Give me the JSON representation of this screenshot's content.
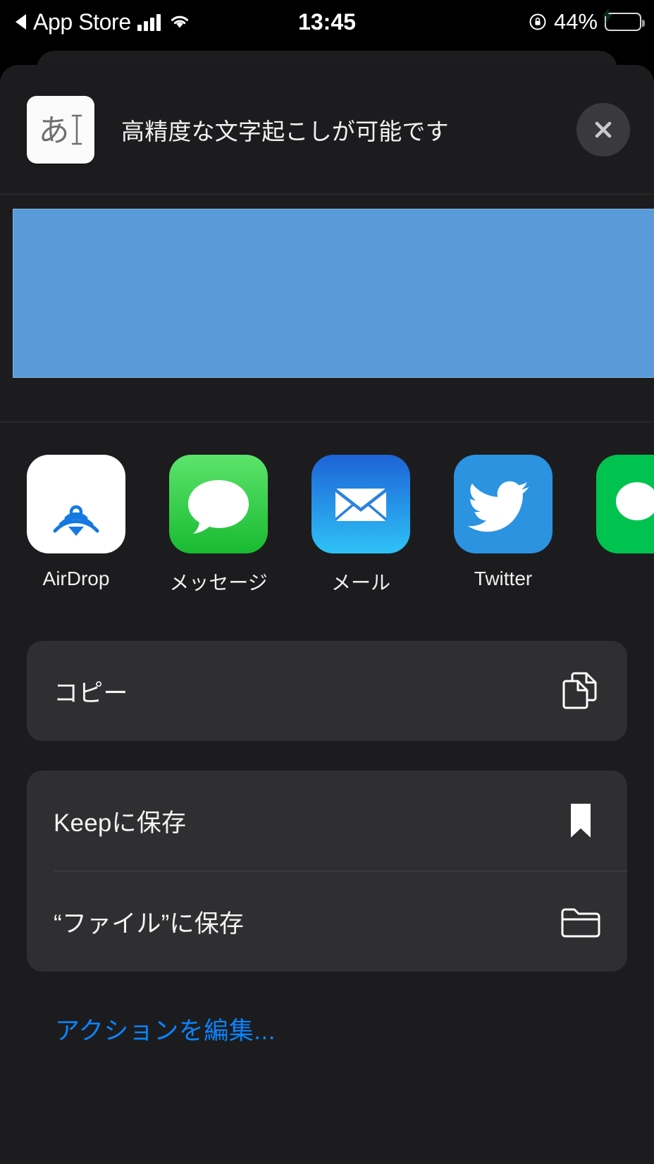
{
  "status_bar": {
    "back_arrow_icon": "triangle-left-icon",
    "carrier_return_app": "App Store",
    "signal_icon": "cellular-signal-icon",
    "wifi_icon": "wifi-icon",
    "time": "13:45",
    "rotation_lock_icon": "rotation-lock-icon",
    "battery_percent": "44%",
    "battery_icon": "battery-charging-icon"
  },
  "sheet": {
    "app_icon_name": "japanese-text-recognition-icon",
    "app_icon_glyph": "あ",
    "app_icon_cursor": "I",
    "title": "高精度な文字起こしが可能です",
    "close_icon": "close-icon"
  },
  "preview": {
    "name": "shared-image-preview",
    "color": "#589bd8"
  },
  "apps": [
    {
      "label": "AirDrop",
      "icon": "airdrop-icon",
      "color": "#ffffff"
    },
    {
      "label": "メッセージ",
      "icon": "messages-icon",
      "color": "#34c759"
    },
    {
      "label": "メール",
      "icon": "mail-icon",
      "color": "#1d8fe8"
    },
    {
      "label": "Twitter",
      "icon": "twitter-icon",
      "color": "#1d9bf0"
    },
    {
      "label": "",
      "icon": "line-icon",
      "color": "#00c34f"
    }
  ],
  "actions": {
    "copy": {
      "label": "コピー",
      "icon": "copy-documents-icon"
    },
    "save_keep": {
      "label": "Keepに保存",
      "icon": "bookmark-icon"
    },
    "save_files": {
      "label": "“ファイル”に保存",
      "icon": "folder-icon"
    }
  },
  "edit_actions": {
    "label": "アクションを編集...",
    "color": "#0a84ff"
  }
}
